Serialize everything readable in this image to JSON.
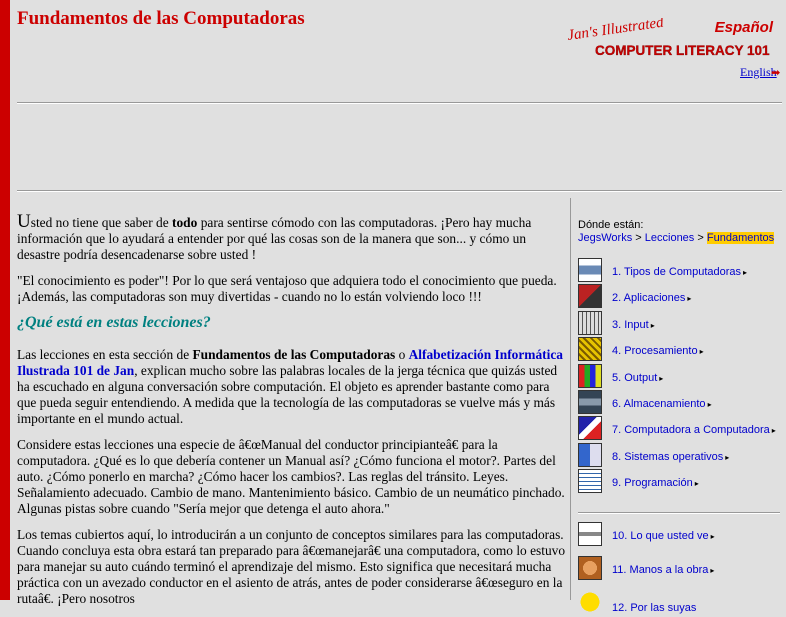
{
  "header": {
    "title": "Fundamentos de las Computadoras",
    "logo": {
      "line1": "Jan's Illustrated",
      "line2": "COMPUTER LITERACY 101",
      "lang": "Español"
    },
    "lang_link": "English"
  },
  "content": {
    "p1_cap": "U",
    "p1_a": "sted no tiene que saber de ",
    "p1_bold": "todo",
    "p1_b": " para sentirse cómodo con las computadoras. ¡Pero hay mucha información que lo ayudará a entender por qué las cosas son de la manera que son... y cómo un desastre podría desencadenarse sobre usted !",
    "p2": "\"El conocimiento es poder\"! Por lo que será ventajoso que adquiera todo el conocimiento que pueda. ¡Además, las computadoras son muy divertidas - cuando no lo están volviendo loco !!!",
    "heading": "¿Qué está en estas lecciones?",
    "p3_a": "Las lecciones en esta sección de ",
    "p3_bold": "Fundamentos de las Computadoras",
    "p3_o": " o ",
    "p3_link": "Alfabetización Informática Ilustrada 101 de Jan",
    "p3_b": ", explican mucho sobre las palabras locales de la jerga técnica que quizás usted ha escuchado en alguna conversación sobre computación. El objeto es aprender bastante como para que pueda seguir entendiendo. A medida que la tecnología de las computadoras se vuelve más y más importante en el mundo actual.",
    "p4": "Considere estas lecciones una especie de â€œManual del conductor principianteâ€ para la computadora. ¿Qué es lo que debería contener un Manual así? ¿Cómo funciona el motor?. Partes del auto. ¿Cómo ponerlo en marcha? ¿Cómo hacer los cambios?. Las reglas del tránsito. Leyes. Señalamiento adecuado. Cambio de mano. Mantenimiento básico. Cambio de un neumático pinchado. Algunas pistas sobre cuando \"Sería mejor que detenga el auto ahora.\"",
    "p5": "Los temas cubiertos aquí, lo introducirán a un conjunto de conceptos similares para las computadoras. Cuando concluya esta obra estará tan preparado para â€œmanejarâ€ una computadora, como lo estuvo para manejar su auto cuándo terminó el aprendizaje del mismo. Esto significa que necesitará mucha práctica con un avezado conductor en el asiento de atrás, antes de poder considerarse â€œseguro en la rutaâ€. ¡Pero nosotros"
  },
  "sidebar": {
    "where_label": "Dónde están:",
    "crumbs": [
      "JegsWorks",
      "Lecciones",
      "Fundamentos"
    ],
    "crumb_sep": ">",
    "items": [
      {
        "label": "1. Tipos de Computadoras",
        "icon": "computer-types-icon"
      },
      {
        "label": "2. Aplicaciones",
        "icon": "applications-icon"
      },
      {
        "label": "3. Input",
        "icon": "keyboard-icon"
      },
      {
        "label": "4. Procesamiento",
        "icon": "chip-icon"
      },
      {
        "label": "5. Output",
        "icon": "monitor-icon"
      },
      {
        "label": "6. Almacenamiento",
        "icon": "storage-icon"
      },
      {
        "label": "7. Computadora a Computadora",
        "icon": "network-icon"
      },
      {
        "label": "8. Sistemas operativos",
        "icon": "os-icon"
      },
      {
        "label": "9. Programación",
        "icon": "programming-icon"
      }
    ],
    "extra_items": [
      {
        "label": "10. Lo que usted ve",
        "icon": "eye-icon"
      },
      {
        "label": "11. Manos a la obra",
        "icon": "hands-icon"
      },
      {
        "label": "12. Por las suyas",
        "icon": "smiley-icon"
      }
    ],
    "arrow_glyph": "▸"
  },
  "colors": {
    "accent_red": "#cc0000",
    "link_blue": "#0000cc",
    "heading_teal": "#008080",
    "highlight": "#ffcc00",
    "background": "#e0e0e0"
  }
}
